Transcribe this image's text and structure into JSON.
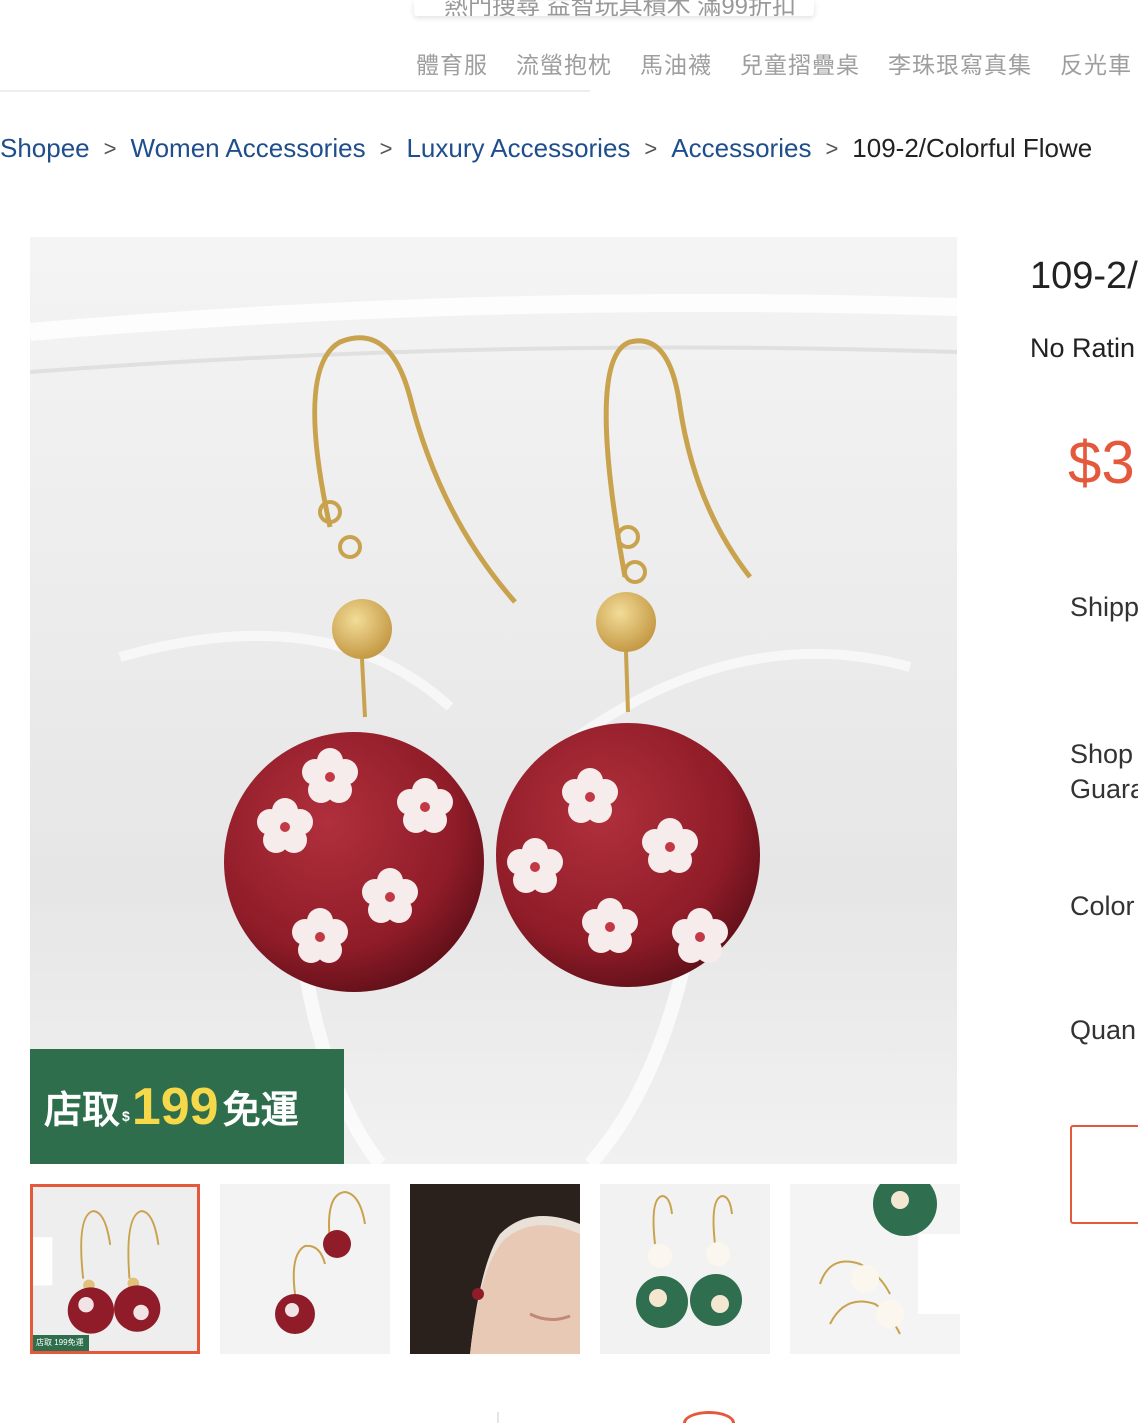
{
  "header": {
    "search_hint": "熱門搜尋 益智玩具積木 滿99折扣",
    "hint_keywords": [
      "體育服",
      "流螢抱枕",
      "馬油襪",
      "兒童摺疊桌",
      "李珠珢寫真集",
      "反光車"
    ]
  },
  "breadcrumb": {
    "items": [
      "Shopee",
      "Women Accessories",
      "Luxury Accessories",
      "Accessories"
    ],
    "current": "109-2/Colorful Flowe"
  },
  "product": {
    "title": "109-2/",
    "rating": "No Ratin",
    "price": "$3"
  },
  "promo_badge": {
    "part1": "店取",
    "currency": "$",
    "amount": "199",
    "part2": "免運"
  },
  "mini_badge": "店取 199免運",
  "attributes": {
    "shipping": "Shipp",
    "guarantee_line1": "Shop",
    "guarantee_line2": "Guara",
    "color": "Color",
    "quantity": "Quan"
  },
  "colors": {
    "accent": "#e4593b",
    "link": "#1f4e8c",
    "promo_green": "#2e6e4c",
    "promo_yellow": "#f6d94a",
    "bead_red": "#8f1c28"
  },
  "thumbnails": [
    {
      "name": "thumb-red-earrings",
      "active": true
    },
    {
      "name": "thumb-red-earrings-side",
      "active": false
    },
    {
      "name": "thumb-model-wearing",
      "active": false
    },
    {
      "name": "thumb-green-earrings",
      "active": false
    },
    {
      "name": "thumb-pearl-hooks",
      "active": false
    }
  ]
}
